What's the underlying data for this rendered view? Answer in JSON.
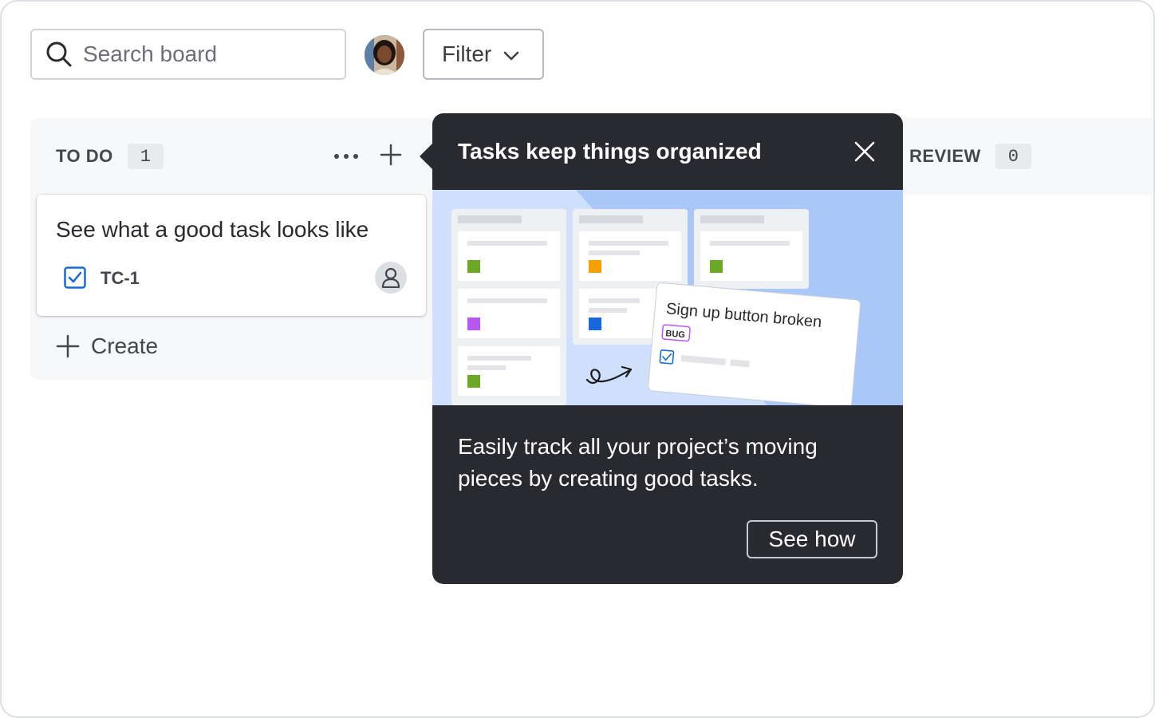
{
  "search": {
    "placeholder": "Search board"
  },
  "filter": {
    "label": "Filter"
  },
  "columns": [
    {
      "title": "TO DO",
      "count": "1",
      "cards": [
        {
          "title": "See what a good task looks like",
          "key": "TC-1"
        }
      ],
      "create_label": "Create"
    },
    {
      "title": "REVIEW",
      "count": "0"
    }
  ],
  "spotlight": {
    "title": "Tasks keep things organized",
    "body": "Easily track all your project’s moving pieces by creating good tasks.",
    "cta": "See how",
    "illustration": {
      "card_title": "Sign up button broken",
      "card_badge": "BUG"
    }
  },
  "colors": {
    "spotlight_bg": "#282a2f",
    "illustration_bg": "#cfe0fc",
    "check_blue": "#1868db",
    "column_bg": "#f7f8f9"
  }
}
